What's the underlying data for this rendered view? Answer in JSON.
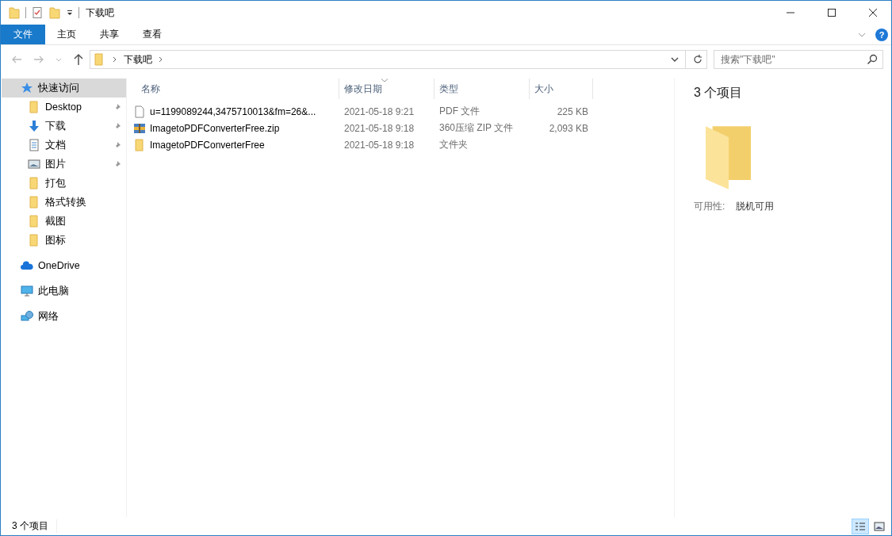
{
  "window": {
    "title": "下载吧"
  },
  "ribbon": {
    "tabs": [
      {
        "label": "文件",
        "kind": "file",
        "selected": false
      },
      {
        "label": "主页",
        "kind": "tab",
        "selected": false
      },
      {
        "label": "共享",
        "kind": "tab",
        "selected": false
      },
      {
        "label": "查看",
        "kind": "tab",
        "selected": false
      }
    ],
    "help": "?"
  },
  "address": {
    "path": [
      "下载吧"
    ]
  },
  "search": {
    "placeholder": "搜索\"下载吧\""
  },
  "sidebar": {
    "items": [
      {
        "label": "快速访问",
        "kind": "star",
        "selected": true,
        "children": [
          {
            "label": "Desktop",
            "kind": "folder",
            "pinned": true
          },
          {
            "label": "下载",
            "kind": "download",
            "pinned": true
          },
          {
            "label": "文档",
            "kind": "document",
            "pinned": true
          },
          {
            "label": "图片",
            "kind": "picture",
            "pinned": true
          },
          {
            "label": "打包",
            "kind": "folder",
            "pinned": false
          },
          {
            "label": "格式转换",
            "kind": "folder",
            "pinned": false
          },
          {
            "label": "截图",
            "kind": "folder",
            "pinned": false
          },
          {
            "label": "图标",
            "kind": "folder",
            "pinned": false
          }
        ]
      },
      {
        "label": "OneDrive",
        "kind": "cloud",
        "selected": false
      },
      {
        "label": "此电脑",
        "kind": "computer",
        "selected": false
      },
      {
        "label": "网络",
        "kind": "network",
        "selected": false
      }
    ]
  },
  "table": {
    "columns": [
      {
        "label": "名称",
        "sorted": false
      },
      {
        "label": "修改日期",
        "sorted": true
      },
      {
        "label": "类型",
        "sorted": false
      },
      {
        "label": "大小",
        "sorted": false
      }
    ],
    "rows": [
      {
        "name": "u=1199089244,3475710013&fm=26&...",
        "kind": "file",
        "date": "2021-05-18 9:21",
        "type": "PDF 文件",
        "size": "225 KB"
      },
      {
        "name": "ImagetoPDFConverterFree.zip",
        "kind": "archive",
        "date": "2021-05-18 9:18",
        "type": "360压缩 ZIP 文件",
        "size": "2,093 KB"
      },
      {
        "name": "ImagetoPDFConverterFree",
        "kind": "folder",
        "date": "2021-05-18 9:18",
        "type": "文件夹"
      }
    ]
  },
  "preview": {
    "count": "3 个项目",
    "property": {
      "label": "可用性:",
      "value": "脱机可用"
    }
  },
  "status_bar": {
    "text": "3 个项目",
    "views": [
      {
        "kind": "details",
        "selected": true
      },
      {
        "kind": "large-icons",
        "selected": false
      }
    ]
  }
}
